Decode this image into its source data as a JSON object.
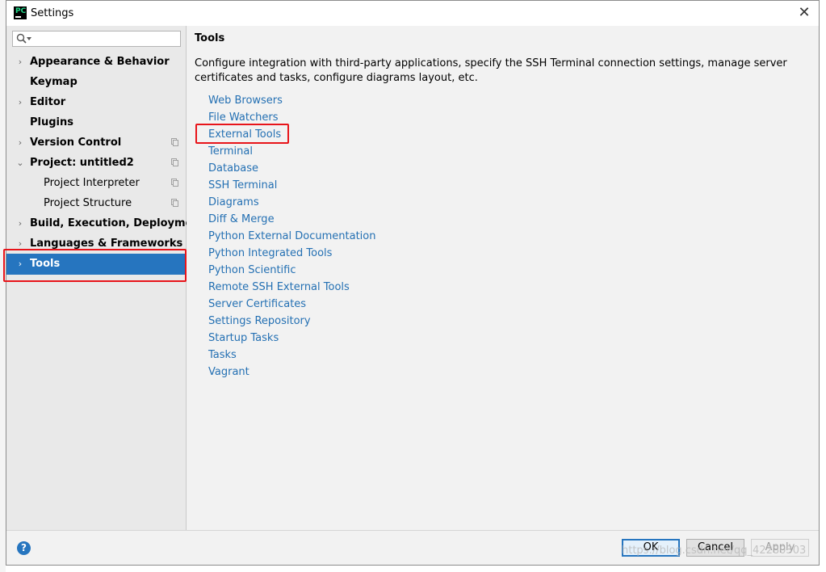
{
  "window": {
    "title": "Settings",
    "app_icon_text": "PC"
  },
  "search": {
    "placeholder": ""
  },
  "tree": [
    {
      "label": "Appearance & Behavior",
      "bold": true,
      "arrow": "›"
    },
    {
      "label": "Keymap",
      "bold": true,
      "arrow": ""
    },
    {
      "label": "Editor",
      "bold": true,
      "arrow": "›"
    },
    {
      "label": "Plugins",
      "bold": true,
      "arrow": ""
    },
    {
      "label": "Version Control",
      "bold": true,
      "arrow": "›",
      "project_icon": true
    },
    {
      "label": "Project: untitled2",
      "bold": true,
      "arrow": "⌄",
      "project_icon": true
    },
    {
      "label": "Project Interpreter",
      "bold": false,
      "arrow": "",
      "project_icon": true
    },
    {
      "label": "Project Structure",
      "bold": false,
      "arrow": "",
      "project_icon": true
    },
    {
      "label": "Build, Execution, Deployment",
      "bold": true,
      "arrow": "›"
    },
    {
      "label": "Languages & Frameworks",
      "bold": true,
      "arrow": "›"
    },
    {
      "label": "Tools",
      "bold": true,
      "arrow": "›",
      "selected": true
    }
  ],
  "content": {
    "heading": "Tools",
    "description": "Configure integration with third-party applications, specify the SSH Terminal connection settings, manage server certificates and tasks, configure diagrams layout, etc.",
    "links": [
      "Web Browsers",
      "File Watchers",
      "External Tools",
      "Terminal",
      "Database",
      "SSH Terminal",
      "Diagrams",
      "Diff & Merge",
      "Python External Documentation",
      "Python Integrated Tools",
      "Python Scientific",
      "Remote SSH External Tools",
      "Server Certificates",
      "Settings Repository",
      "Startup Tasks",
      "Tasks",
      "Vagrant"
    ]
  },
  "footer": {
    "help": "?",
    "ok": "OK",
    "cancel": "Cancel",
    "apply": "Apply"
  },
  "watermark": "https://blog.csdn.net/qq_42280303",
  "colors": {
    "selection": "#2675bf",
    "link": "#2470b3",
    "annotation": "#e8141a"
  }
}
